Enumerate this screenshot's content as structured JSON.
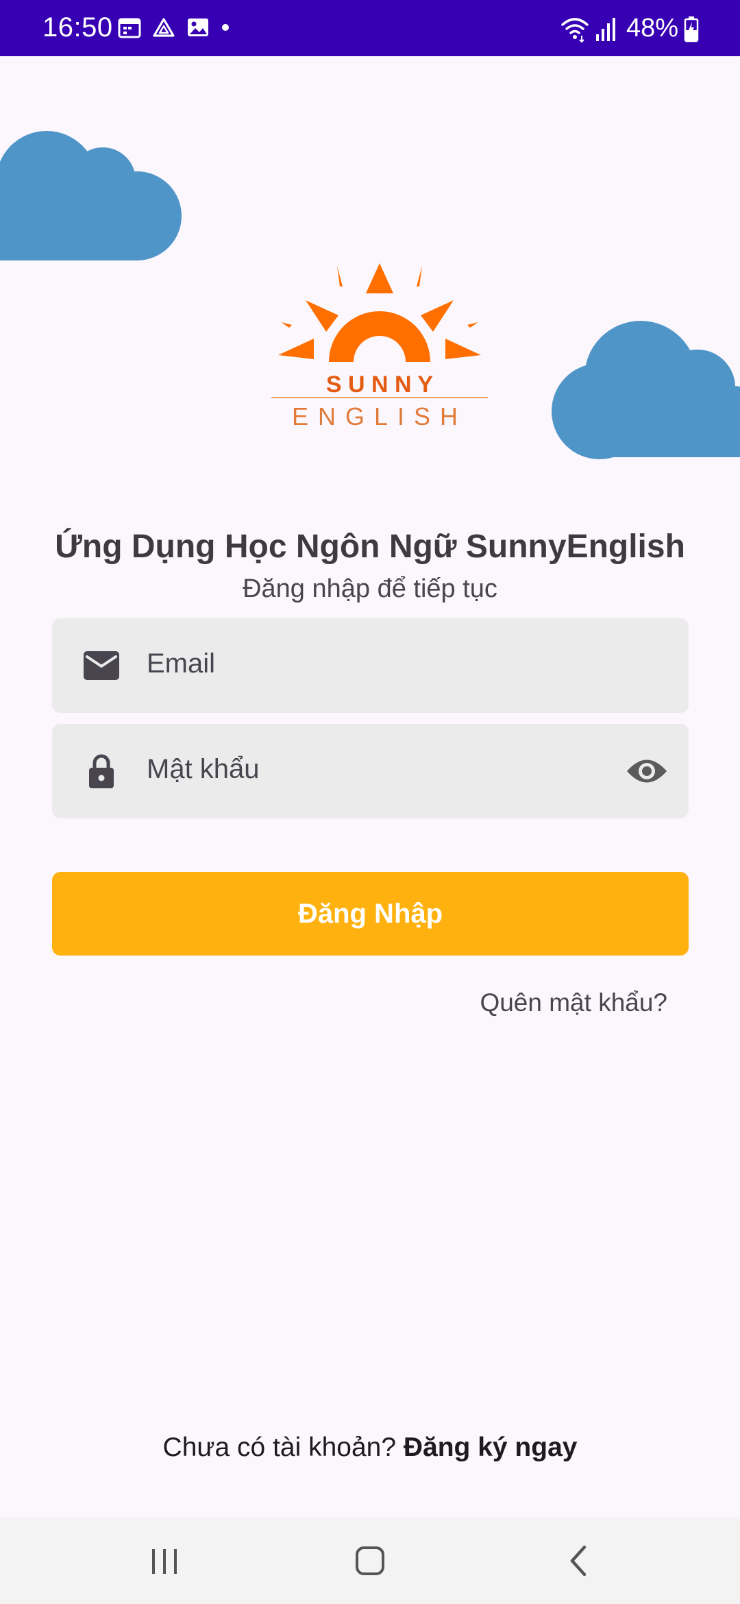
{
  "status_bar": {
    "time": "16:50",
    "battery": "48%",
    "icons_left": [
      "calendar-icon",
      "drive-icon",
      "gallery-icon",
      "dot-icon"
    ],
    "icons_right": [
      "wifi-icon",
      "signal-icon",
      "battery-charging-icon"
    ]
  },
  "logo": {
    "line1": "S U N N Y",
    "line2": "ENGLISH",
    "color": "#ff6f00"
  },
  "header": {
    "title": "Ứng Dụng Học Ngôn Ngữ SunnyEnglish",
    "subtitle": "Đăng nhập để tiếp tục"
  },
  "form": {
    "email": {
      "placeholder": "Email",
      "icon": "email-icon"
    },
    "password": {
      "placeholder": "Mật khẩu",
      "icon": "lock-icon",
      "toggle_icon": "eye-icon"
    },
    "login_label": "Đăng Nhập",
    "forgot_label": "Quên mật khẩu?"
  },
  "footer": {
    "prompt": "Chưa có tài khoản? ",
    "signup_label": "Đăng ký ngay"
  },
  "colors": {
    "status_bar": "#3700b3",
    "background": "#fcf7fd",
    "cloud": "#4f95c8",
    "button": "#ffb20f",
    "field": "#ebebeb"
  },
  "nav_bar": {
    "buttons": [
      "recents-icon",
      "home-icon",
      "back-icon"
    ]
  }
}
